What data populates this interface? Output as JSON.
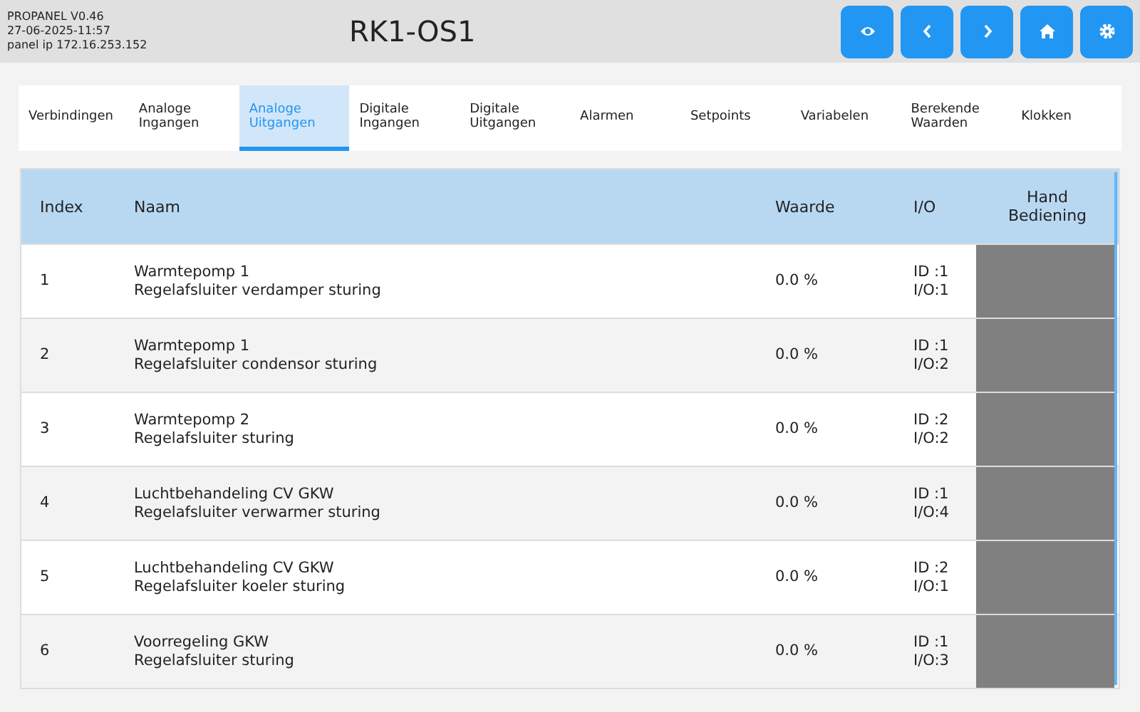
{
  "header": {
    "info": [
      "PROPANEL V0.46",
      "27-06-2025-11:57",
      "panel ip 172.16.253.152"
    ],
    "title": "RK1-OS1",
    "buttons": [
      {
        "kind": "eye"
      },
      {
        "kind": "prev"
      },
      {
        "kind": "next"
      },
      {
        "kind": "home"
      },
      {
        "kind": "settings"
      }
    ]
  },
  "tabs": [
    {
      "label": "Verbindingen",
      "selected": false
    },
    {
      "label": "Analoge\nIngangen",
      "selected": false
    },
    {
      "label": "Analoge\nUitgangen",
      "selected": true
    },
    {
      "label": "Digitale\nIngangen",
      "selected": false
    },
    {
      "label": "Digitale\nUitgangen",
      "selected": false
    },
    {
      "label": "Alarmen",
      "selected": false
    },
    {
      "label": "Setpoints",
      "selected": false
    },
    {
      "label": "Variabelen",
      "selected": false
    },
    {
      "label": "Berekende\nWaarden",
      "selected": false
    },
    {
      "label": "Klokken",
      "selected": false
    }
  ],
  "table": {
    "columns": [
      "Index",
      "Naam",
      "Waarde",
      "I/O",
      "Hand\nBediening"
    ],
    "rows": [
      {
        "index": "1",
        "name": "Warmtepomp 1\nRegelafsluiter verdamper sturing",
        "value": "0.0 %",
        "io": "ID :1\nI/O:1"
      },
      {
        "index": "2",
        "name": "Warmtepomp 1\nRegelafsluiter condensor sturing",
        "value": "0.0 %",
        "io": "ID :1\nI/O:2"
      },
      {
        "index": "3",
        "name": "Warmtepomp 2\nRegelafsluiter sturing",
        "value": "0.0 %",
        "io": "ID :2\nI/O:2"
      },
      {
        "index": "4",
        "name": "Luchtbehandeling CV GKW\nRegelafsluiter verwarmer sturing",
        "value": "0.0 %",
        "io": "ID :1\nI/O:4"
      },
      {
        "index": "5",
        "name": "Luchtbehandeling CV GKW\nRegelafsluiter koeler sturing",
        "value": "0.0 %",
        "io": "ID :2\nI/O:1"
      },
      {
        "index": "6",
        "name": "Voorregeling GKW\nRegelafsluiter sturing",
        "value": "0.0 %",
        "io": "ID :1\nI/O:3"
      }
    ]
  }
}
